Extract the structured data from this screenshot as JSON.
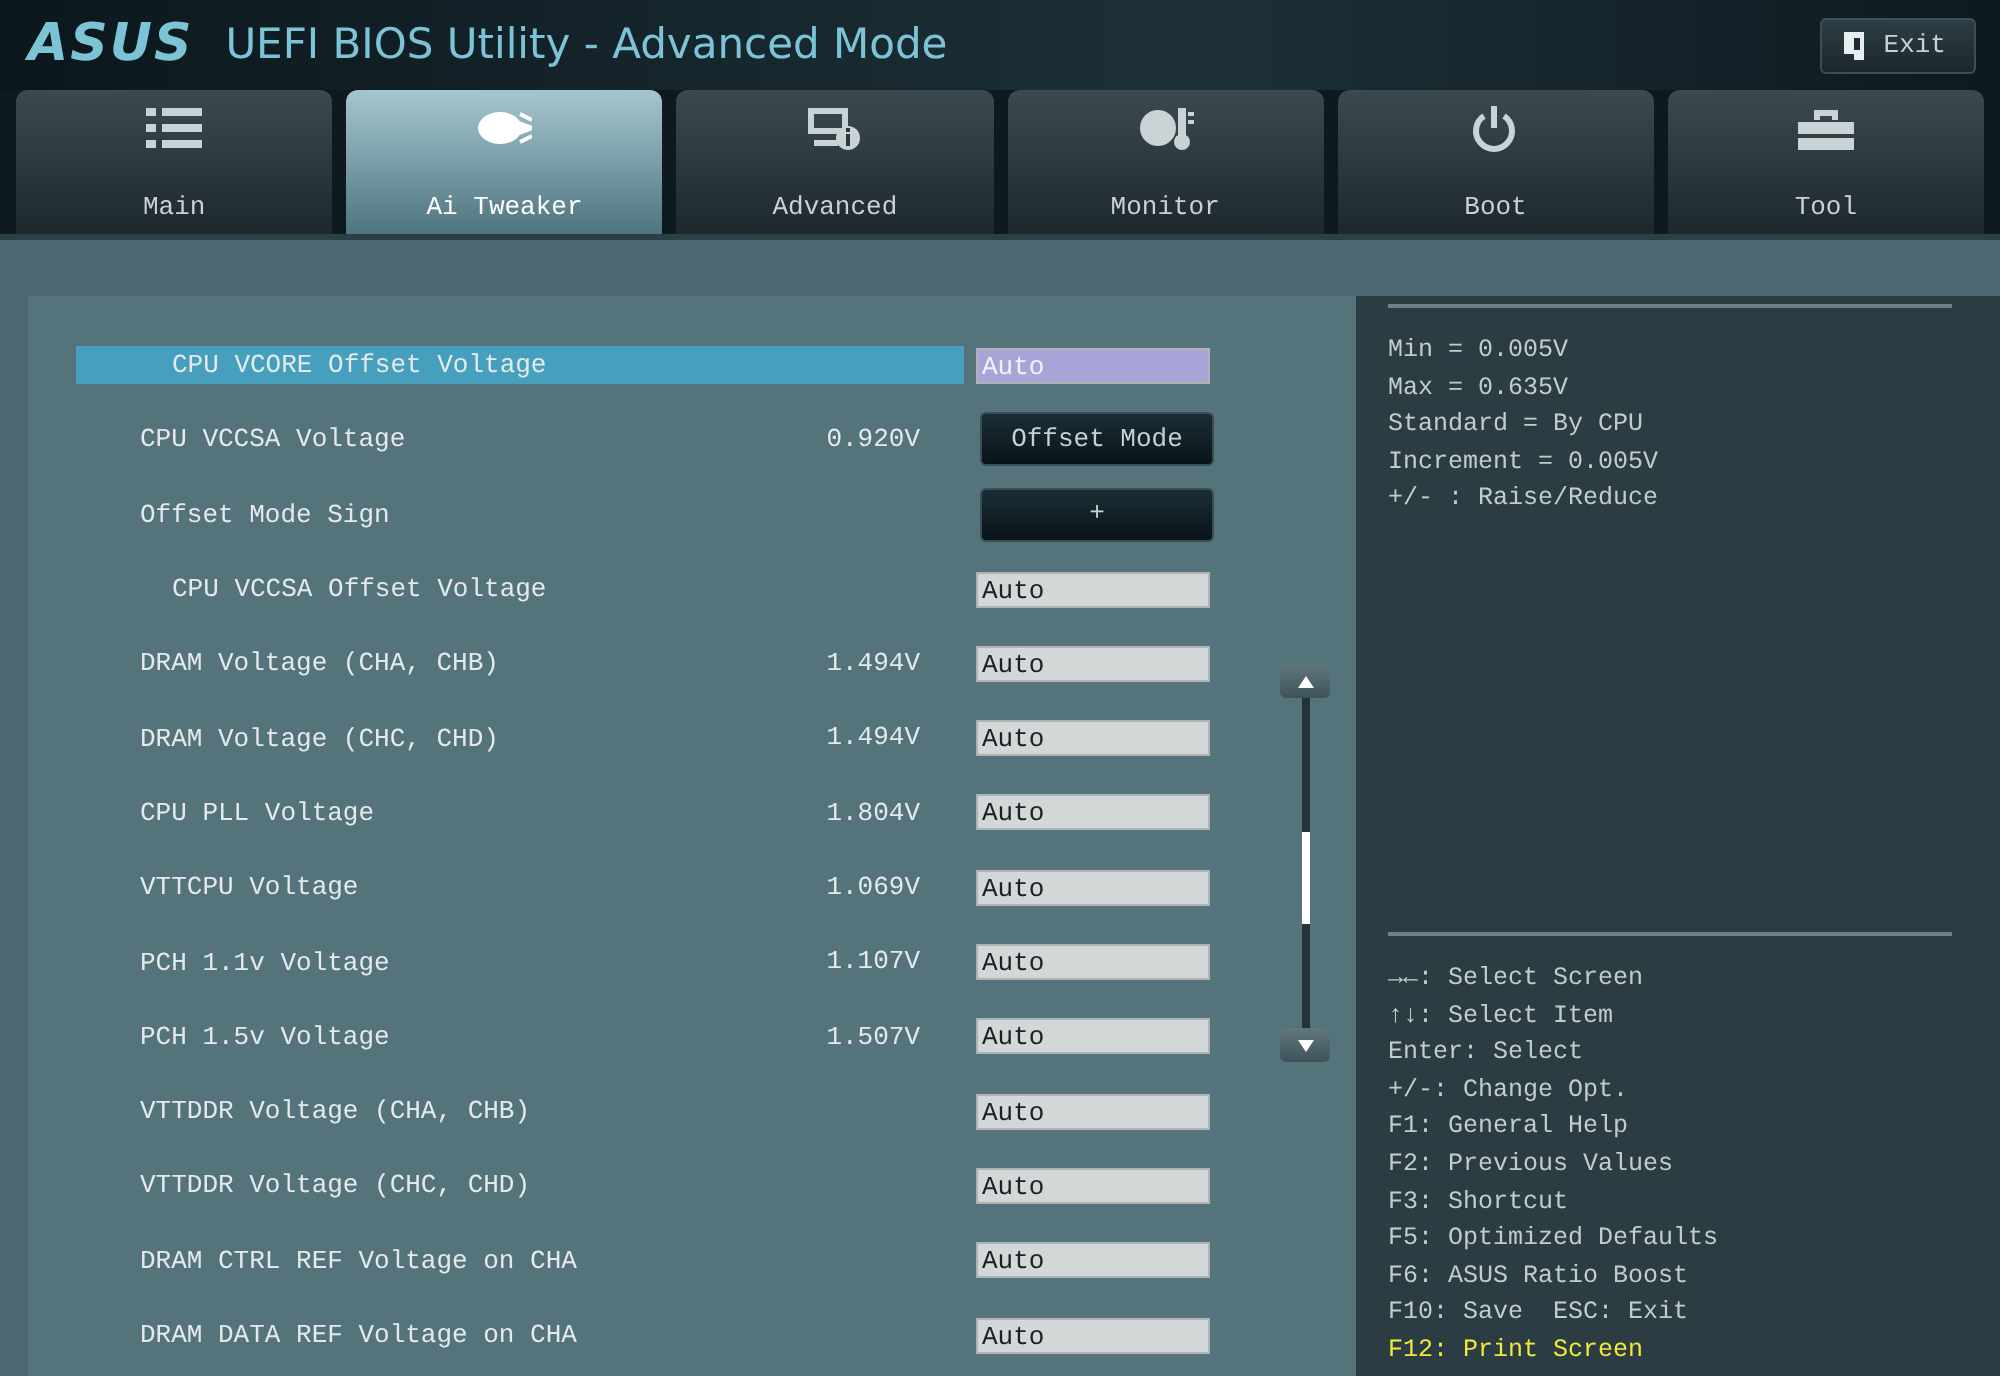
{
  "header": {
    "logo": "ASUS",
    "title": "UEFI BIOS Utility - Advanced Mode",
    "exit_button": "Exit"
  },
  "tabs": [
    {
      "label": "Main",
      "selected": false
    },
    {
      "label": "Ai Tweaker",
      "selected": true
    },
    {
      "label": "Advanced",
      "selected": false
    },
    {
      "label": "Monitor",
      "selected": false
    },
    {
      "label": "Boot",
      "selected": false
    },
    {
      "label": "Tool",
      "selected": false
    }
  ],
  "settings": [
    {
      "label": "CPU VCORE Offset Voltage",
      "indented": true,
      "value": "Auto",
      "kind": "field",
      "selected": true
    },
    {
      "label": "CPU VCCSA Voltage",
      "indented": false,
      "reading": "0.920V",
      "value": "Offset Mode",
      "kind": "button",
      "selected": false
    },
    {
      "label": "Offset Mode Sign",
      "indented": false,
      "value": "+",
      "kind": "button",
      "selected": false
    },
    {
      "label": "CPU VCCSA Offset Voltage",
      "indented": true,
      "value": "Auto",
      "kind": "field",
      "selected": false
    },
    {
      "label": "DRAM Voltage (CHA, CHB)",
      "indented": false,
      "reading": "1.494V",
      "value": "Auto",
      "kind": "field",
      "selected": false
    },
    {
      "label": "DRAM Voltage (CHC, CHD)",
      "indented": false,
      "reading": "1.494V",
      "value": "Auto",
      "kind": "field",
      "selected": false
    },
    {
      "label": "CPU PLL Voltage",
      "indented": false,
      "reading": "1.804V",
      "value": "Auto",
      "kind": "field",
      "selected": false
    },
    {
      "label": "VTTCPU Voltage",
      "indented": false,
      "reading": "1.069V",
      "value": "Auto",
      "kind": "field",
      "selected": false
    },
    {
      "label": "PCH 1.1v Voltage",
      "indented": false,
      "reading": "1.107V",
      "value": "Auto",
      "kind": "field",
      "selected": false
    },
    {
      "label": "PCH 1.5v Voltage",
      "indented": false,
      "reading": "1.507V",
      "value": "Auto",
      "kind": "field",
      "selected": false
    },
    {
      "label": "VTTDDR Voltage (CHA, CHB)",
      "indented": false,
      "value": "Auto",
      "kind": "field",
      "selected": false
    },
    {
      "label": "VTTDDR Voltage (CHC, CHD)",
      "indented": false,
      "value": "Auto",
      "kind": "field",
      "selected": false
    },
    {
      "label": "DRAM CTRL REF Voltage on CHA",
      "indented": false,
      "value": "Auto",
      "kind": "field",
      "selected": false
    },
    {
      "label": "DRAM DATA REF Voltage on CHA",
      "indented": false,
      "value": "Auto",
      "kind": "field",
      "selected": false
    }
  ],
  "help": [
    "Min = 0.005V",
    "Max = 0.635V",
    "Standard = By CPU",
    "Increment = 0.005V",
    "+/- : Raise/Reduce"
  ],
  "keys": [
    {
      "text": "→←: Select Screen",
      "highlighted": false
    },
    {
      "text": "↑↓: Select Item",
      "highlighted": false
    },
    {
      "text": "Enter: Select",
      "highlighted": false
    },
    {
      "text": "+/-: Change Opt.",
      "highlighted": false
    },
    {
      "text": "F1: General Help",
      "highlighted": false
    },
    {
      "text": "F2: Previous Values",
      "highlighted": false
    },
    {
      "text": "F3: Shortcut",
      "highlighted": false
    },
    {
      "text": "F5: Optimized Defaults",
      "highlighted": false
    },
    {
      "text": "F6: ASUS Ratio Boost",
      "highlighted": false
    },
    {
      "text": "F10: Save  ESC: Exit",
      "highlighted": false
    },
    {
      "text": "F12: Print Screen",
      "highlighted": true
    }
  ]
}
